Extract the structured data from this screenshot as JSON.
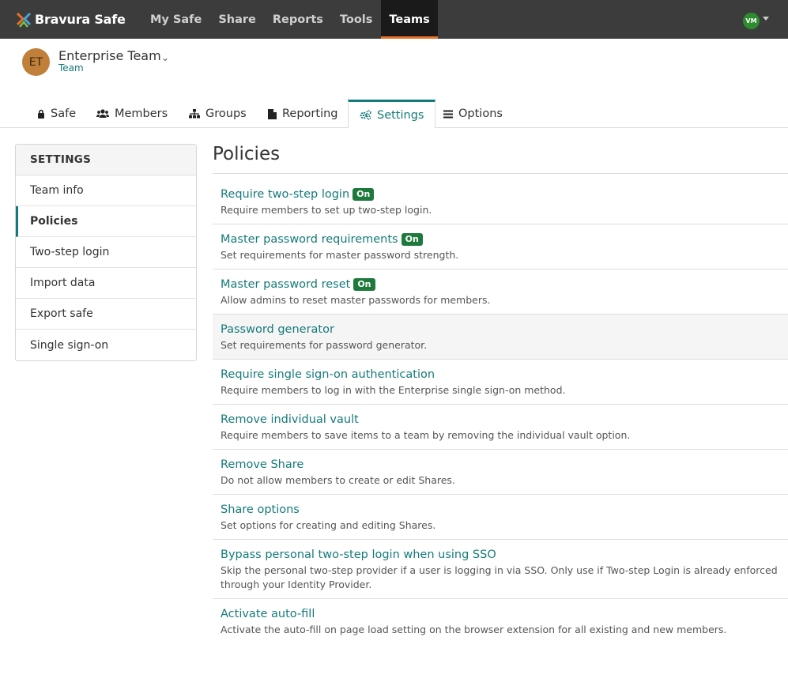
{
  "nav": {
    "brand": "Bravura Safe",
    "items": [
      {
        "label": "My Safe",
        "name": "nav-my-safe"
      },
      {
        "label": "Share",
        "name": "nav-share"
      },
      {
        "label": "Reports",
        "name": "nav-reports"
      },
      {
        "label": "Tools",
        "name": "nav-tools"
      },
      {
        "label": "Teams",
        "name": "nav-teams",
        "active": true
      }
    ],
    "user_initials": "VM",
    "accent_color": "#e8702a"
  },
  "team": {
    "initials": "ET",
    "name": "Enterprise Team",
    "type": "Team"
  },
  "tabs": [
    {
      "label": "Safe",
      "icon": "lock-icon"
    },
    {
      "label": "Members",
      "icon": "users-icon"
    },
    {
      "label": "Groups",
      "icon": "sitemap-icon"
    },
    {
      "label": "Reporting",
      "icon": "file-icon"
    },
    {
      "label": "Settings",
      "icon": "gears-icon",
      "active": true
    },
    {
      "label": "Options",
      "icon": "bars-icon"
    }
  ],
  "sidebar": {
    "heading": "SETTINGS",
    "items": [
      {
        "label": "Team info"
      },
      {
        "label": "Policies",
        "active": true
      },
      {
        "label": "Two-step login"
      },
      {
        "label": "Import data"
      },
      {
        "label": "Export safe"
      },
      {
        "label": "Single sign-on"
      }
    ]
  },
  "main": {
    "title": "Policies",
    "policies": [
      {
        "title": "Require two-step login",
        "badge": "On",
        "desc": "Require members to set up two-step login."
      },
      {
        "title": "Master password requirements",
        "badge": "On",
        "desc": "Set requirements for master password strength."
      },
      {
        "title": "Master password reset",
        "badge": "On",
        "desc": "Allow admins to reset master passwords for members."
      },
      {
        "title": "Password generator",
        "badge": "",
        "desc": "Set requirements for password generator.",
        "highlight": true
      },
      {
        "title": "Require single sign-on authentication",
        "badge": "",
        "desc": "Require members to log in with the Enterprise single sign-on method."
      },
      {
        "title": "Remove individual vault",
        "badge": "",
        "desc": "Require members to save items to a team by removing the individual vault option."
      },
      {
        "title": "Remove Share",
        "badge": "",
        "desc": "Do not allow members to create or edit Shares."
      },
      {
        "title": "Share options",
        "badge": "",
        "desc": "Set options for creating and editing Shares."
      },
      {
        "title": "Bypass personal two-step login when using SSO",
        "badge": "",
        "desc": "Skip the personal two-step provider if a user is logging in via SSO. Only use if Two-step Login is already enforced through your Identity Provider."
      },
      {
        "title": "Activate auto-fill",
        "badge": "",
        "desc": "Activate the auto-fill on page load setting on the browser extension for all existing and new members."
      }
    ]
  },
  "colors": {
    "link": "#157a7a",
    "badge_on": "#1e7a3c"
  }
}
